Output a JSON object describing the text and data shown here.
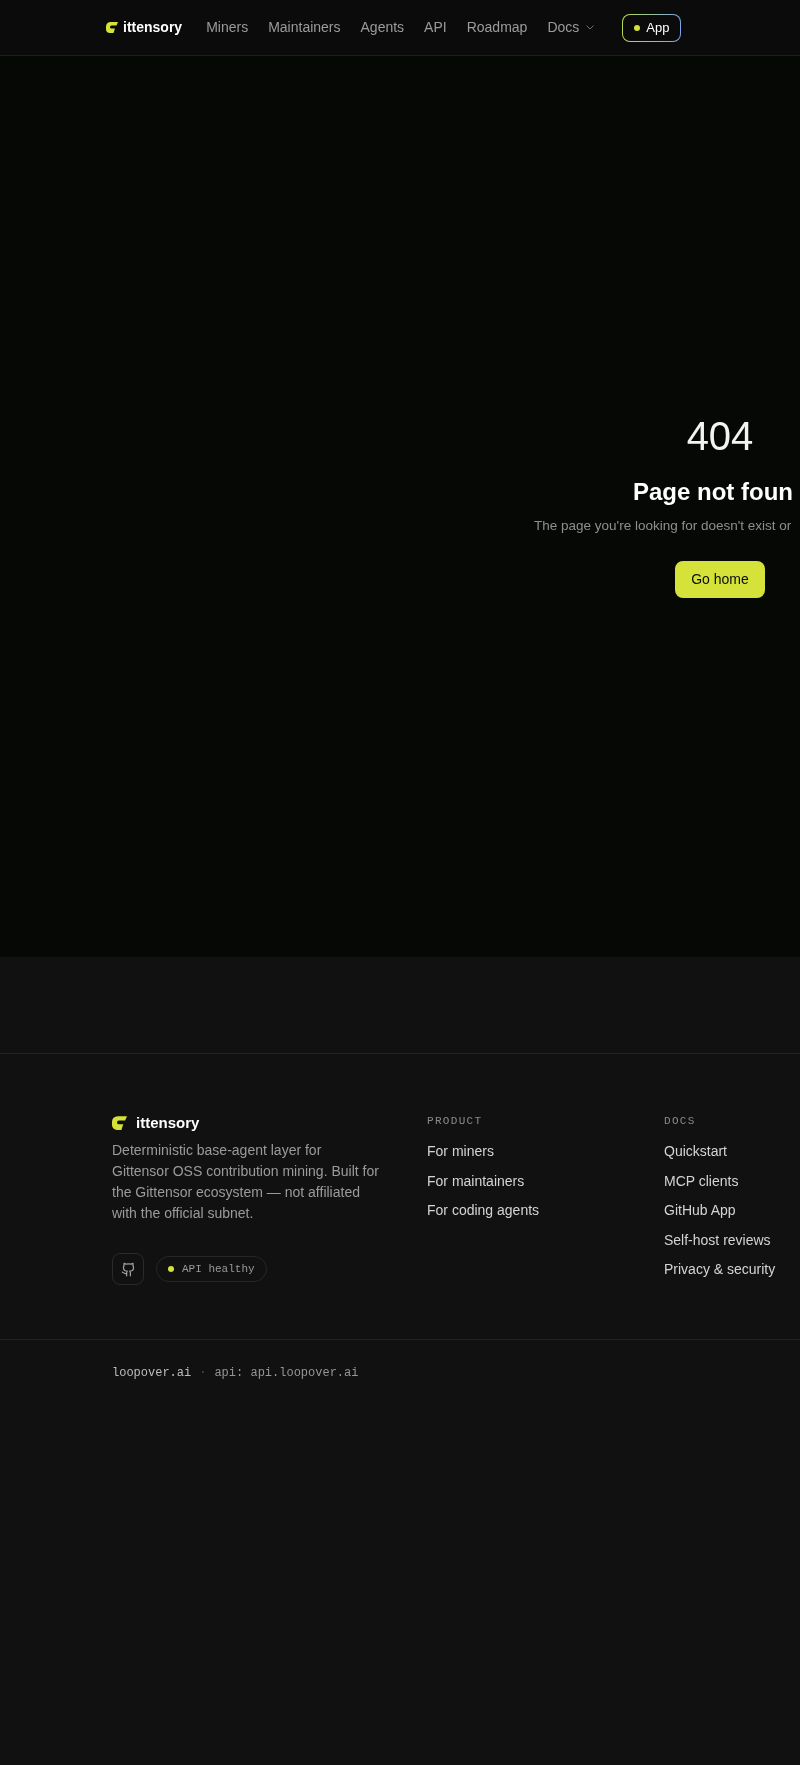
{
  "nav": {
    "brand": "ittensory",
    "links": [
      {
        "label": "Miners"
      },
      {
        "label": "Maintainers"
      },
      {
        "label": "Agents"
      },
      {
        "label": "API"
      },
      {
        "label": "Roadmap"
      }
    ],
    "docs_menu": {
      "label": "Docs"
    },
    "app_button": {
      "label": "App"
    }
  },
  "not_found": {
    "code": "404",
    "title": "Page not foun",
    "message": "The page you're looking for doesn't exist or",
    "button": "Go home"
  },
  "footer": {
    "brand": "ittensory",
    "description": "Deterministic base-agent layer for Gittensor OSS contribution mining. Built for the Gittensor ecosystem — not affiliated with the official subnet.",
    "api_status": "API healthy",
    "columns": [
      {
        "heading": "PRODUCT",
        "links": [
          "For miners",
          "For maintainers",
          "For coding agents"
        ]
      },
      {
        "heading": "DOCS",
        "links": [
          "Quickstart",
          "MCP clients",
          "GitHub App",
          "Self-host reviews",
          "Privacy & security"
        ]
      }
    ],
    "bottom": {
      "site": "loopover.ai",
      "separator": "·",
      "api": "api: api.loopover.ai"
    }
  }
}
